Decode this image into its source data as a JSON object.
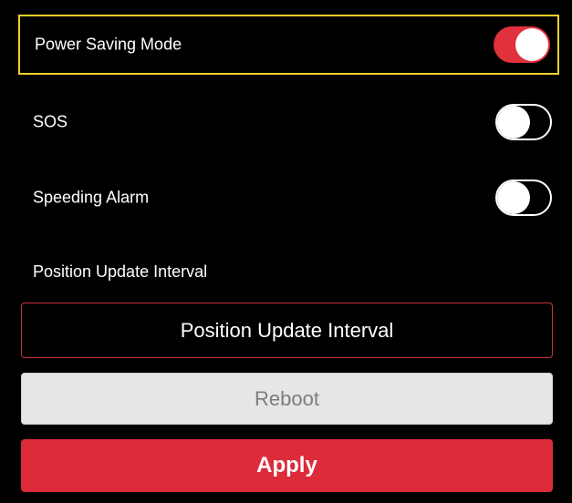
{
  "settings": [
    {
      "label": "Power Saving Mode",
      "on": true
    },
    {
      "label": "SOS",
      "on": false
    },
    {
      "label": "Speeding Alarm",
      "on": false
    }
  ],
  "interval": {
    "section_label": "Position Update Interval",
    "button_label": "Position Update Interval"
  },
  "actions": {
    "reboot_label": "Reboot",
    "apply_label": "Apply"
  },
  "colors": {
    "focus_border": "#f2d02a",
    "toggle_on": "#e0313d",
    "apply_bg": "#dc2b39",
    "reboot_bg": "#e6e6e6",
    "interval_border": "#c8333d"
  }
}
